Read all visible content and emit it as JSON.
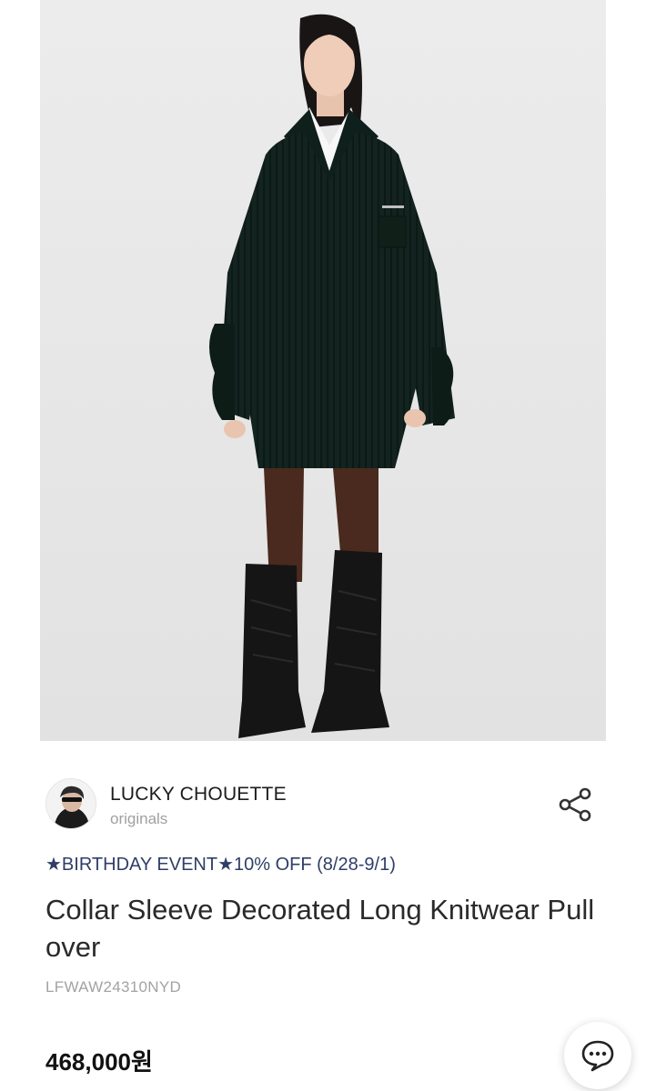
{
  "brand": {
    "name": "LUCKY CHOUETTE",
    "subtitle": "originals"
  },
  "product": {
    "event": "★BIRTHDAY EVENT★10% OFF (8/28-9/1)",
    "title": "Collar Sleeve Decorated Long Knitwear Pullover",
    "code": "LFWAW24310NYD",
    "price": "468,000원",
    "image_description_icon": "product-photo"
  },
  "actions": {
    "share_icon": "share-icon",
    "chat_icon": "chat-bubble-icon"
  },
  "colors": {
    "event_text": "#2f3e66",
    "photo_background": "#e9e9e9",
    "knit": "#13231f"
  }
}
